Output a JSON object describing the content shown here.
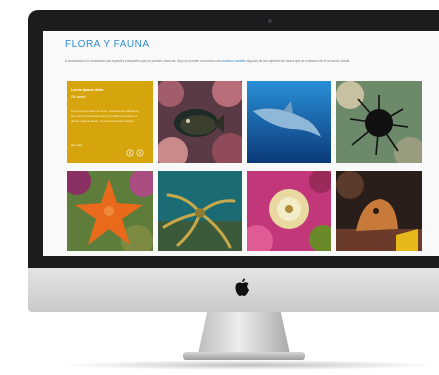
{
  "page": {
    "title": "FLORA Y FAUNA",
    "intro_text": "A continuación le mostramos las especies principales que se pueden observar. Aquí se pueden encontrar más",
    "intro_text_2": "algunas de las especies de fauna que se muestran en el recorrido virtual.",
    "intro_link": "nuestros carteles"
  },
  "info_tile": {
    "title": "Lorem ipsum dolor",
    "subtitle": "Sit amet",
    "text": "Lorem ipsum dolor sit amet, consectetur adipiscing elit, sed do eiusmod tempor incididunt ut labore et dolore magna aliqua. Ut enim ad minim veniam.",
    "link": "Ver más"
  },
  "photos": [
    {
      "name": "grouper-fish-photo"
    },
    {
      "name": "dolphin-photo"
    },
    {
      "name": "sea-urchin-photo"
    },
    {
      "name": "starfish-photo"
    },
    {
      "name": "brittle-star-photo"
    },
    {
      "name": "anemone-photo"
    },
    {
      "name": "blenny-fish-photo"
    }
  ],
  "colors": {
    "accent": "#2f8ccf",
    "info_tile": "#d6a50e",
    "monitor_bezel": "#1b1c1e"
  }
}
